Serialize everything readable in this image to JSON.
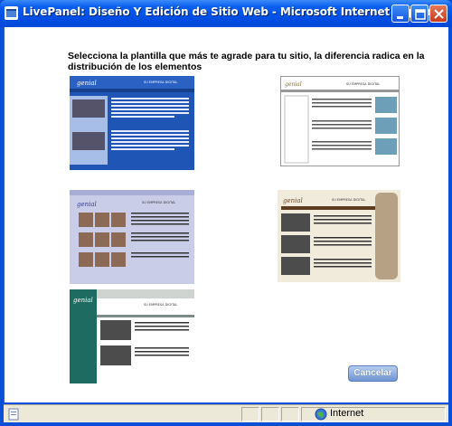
{
  "window": {
    "title": "LivePanel: Diseño Y Edición de Sitio Web - Microsoft Internet Explorer",
    "app_icon": "ie-icon",
    "controls": [
      "minimize-icon",
      "maximize-icon",
      "close-icon"
    ]
  },
  "content": {
    "heading": "Selecciona la plantilla que más te agrade para tu sitio, la diferencia radica en la distribución de los elementos",
    "cancel_label": "Cancelar"
  },
  "templates": [
    {
      "id": "blue",
      "name": "SU EMPRESA DIGITAL",
      "color": "#1f55b5"
    },
    {
      "id": "white",
      "name": "SU EMPRESA DIGITAL",
      "color": "#ffffff"
    },
    {
      "id": "lavender",
      "name": "SU EMPRESA DIGITAL",
      "color": "#c9cde8"
    },
    {
      "id": "beige",
      "name": "SU EMPRESA DIGITAL",
      "color": "#f1ebdc"
    },
    {
      "id": "teal",
      "name": "SU EMPRESA DIGITAL",
      "color": "#1d6b61"
    }
  ],
  "statusbar": {
    "zone_label": "Internet",
    "zone_icon": "globe-icon",
    "page_icon": "page-icon"
  }
}
